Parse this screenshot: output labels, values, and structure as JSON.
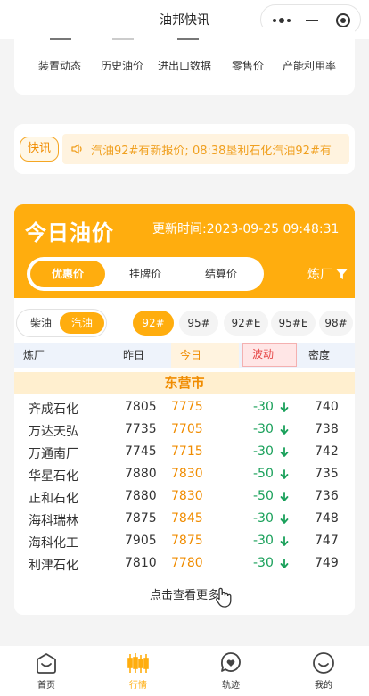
{
  "header": {
    "title": "油邦快讯"
  },
  "categories": [
    "装置动态",
    "历史油价",
    "进出口数据",
    "零售价",
    "产能利用率"
  ],
  "news": {
    "badge": "快讯",
    "text": "汽油92#有新报价; 08:38垦利石化汽油92#有"
  },
  "price": {
    "title": "今日油价",
    "update_time": "更新时间:2023-09-25 09:48:31",
    "tabs": [
      "优惠价",
      "挂牌价",
      "结算价"
    ],
    "active_tab": 0,
    "refinery_filter": "炼厂",
    "fuel_types": [
      "柴油",
      "汽油"
    ],
    "active_fuel": 1,
    "grades": [
      "92#",
      "95#",
      "92#E",
      "95#E",
      "98#"
    ],
    "active_grade": 0,
    "columns": [
      "炼厂",
      "昨日",
      "今日",
      "波动",
      "密度"
    ],
    "city": "东营市",
    "rows": [
      {
        "name": "齐成石化",
        "yesterday": "7805",
        "today": "7775",
        "change": "-30",
        "density": "740"
      },
      {
        "name": "万达天弘",
        "yesterday": "7735",
        "today": "7705",
        "change": "-30",
        "density": "738"
      },
      {
        "name": "万通南厂",
        "yesterday": "7745",
        "today": "7715",
        "change": "-30",
        "density": "742"
      },
      {
        "name": "华星石化",
        "yesterday": "7880",
        "today": "7830",
        "change": "-50",
        "density": "735"
      },
      {
        "name": "正和石化",
        "yesterday": "7880",
        "today": "7830",
        "change": "-50",
        "density": "736"
      },
      {
        "name": "海科瑞林",
        "yesterday": "7875",
        "today": "7845",
        "change": "-30",
        "density": "748"
      },
      {
        "name": "海科化工",
        "yesterday": "7905",
        "today": "7875",
        "change": "-30",
        "density": "747"
      },
      {
        "name": "利津石化",
        "yesterday": "7810",
        "today": "7780",
        "change": "-30",
        "density": "749"
      }
    ],
    "more": "点击查看更多"
  },
  "nav": [
    {
      "label": "首页",
      "icon": "home-icon"
    },
    {
      "label": "行情",
      "icon": "candlestick-icon"
    },
    {
      "label": "轨迹",
      "icon": "track-icon"
    },
    {
      "label": "我的",
      "icon": "profile-icon"
    }
  ],
  "active_nav": 1,
  "colors": {
    "accent": "#ffad0e",
    "down": "#19a05a",
    "today": "#f08c00"
  }
}
